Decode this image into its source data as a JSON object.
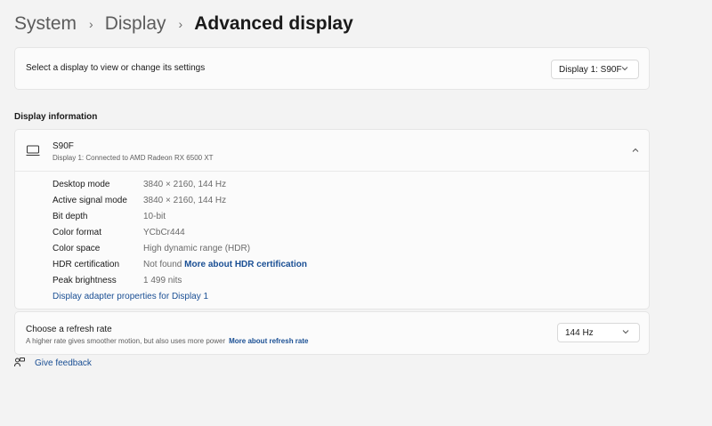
{
  "breadcrumb": {
    "items": [
      "System",
      "Display",
      "Advanced display"
    ],
    "separator": "›"
  },
  "select_display": {
    "label": "Select a display to view or change its settings",
    "dropdown_value": "Display 1: S90F"
  },
  "display_information": {
    "section_title": "Display information",
    "name": "S90F",
    "subtitle": "Display 1: Connected to AMD Radeon RX 6500 XT",
    "rows": [
      {
        "key": "Desktop mode",
        "value": "3840 × 2160, 144 Hz"
      },
      {
        "key": "Active signal mode",
        "value": "3840 × 2160, 144 Hz"
      },
      {
        "key": "Bit depth",
        "value": "10-bit"
      },
      {
        "key": "Color format",
        "value": "YCbCr444"
      },
      {
        "key": "Color space",
        "value": "High dynamic range (HDR)"
      },
      {
        "key": "HDR certification",
        "value": "Not found",
        "link": "More about HDR certification"
      },
      {
        "key": "Peak brightness",
        "value": "1 499 nits"
      }
    ],
    "adapter_link": "Display adapter properties for Display 1"
  },
  "refresh_rate": {
    "title": "Choose a refresh rate",
    "subtitle": "A higher rate gives smoother motion, but also uses more power",
    "link": "More about refresh rate",
    "dropdown_value": "144 Hz"
  },
  "feedback": {
    "label": "Give feedback"
  },
  "colors": {
    "background": "#f3f3f3",
    "card": "#fbfbfb",
    "link": "#1a4f94"
  },
  "icons": [
    "chevron-down-icon",
    "chevron-up-icon",
    "monitor-icon",
    "feedback-icon"
  ]
}
